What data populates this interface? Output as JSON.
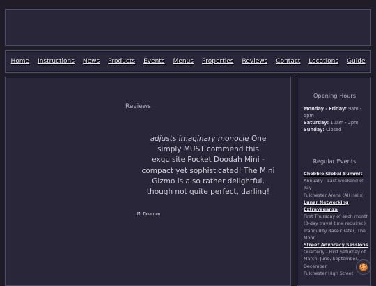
{
  "nav": {
    "items": [
      "Home",
      "Instructions",
      "News",
      "Products",
      "Events",
      "Menus",
      "Properties",
      "Reviews",
      "Contact",
      "Locations",
      "Guide"
    ]
  },
  "main": {
    "title": "Reviews",
    "review": {
      "action": "adjusts imaginary monocle",
      "text": " One simply MUST commend this exquisite Pocket Doodah Mini - compact yet sophisticated! The Mini Gizmo is also rather delightful, though not quite perfect, darling!",
      "author": "Mr Fakeman"
    }
  },
  "sidebar": {
    "hours_title": "Opening Hours",
    "hours": [
      {
        "day": "Monday - Friday:",
        "time": " 9am - 5pm"
      },
      {
        "day": "Saturday:",
        "time": " 10am - 2pm"
      },
      {
        "day": "Sunday:",
        "time": " Closed"
      }
    ],
    "events_title": "Regular Events",
    "events": [
      {
        "name": "Chobble Global Summit",
        "schedule": "Annually - Last weekend of July",
        "location": "Fulchester Arena (All Halls)"
      },
      {
        "name": "Lunar Networking Extravaganza",
        "schedule": "First Thursday of each month (3-day travel time required)",
        "location": "Tranquility Base Crater, The Moon"
      },
      {
        "name": "Street Advocacy Sessions",
        "schedule": "Quarterly - First Saturday of March, June, September, December",
        "location": "Fulchester High Street"
      }
    ]
  },
  "cookie": {
    "icon": "cookie-icon",
    "glyph": "🍪"
  }
}
